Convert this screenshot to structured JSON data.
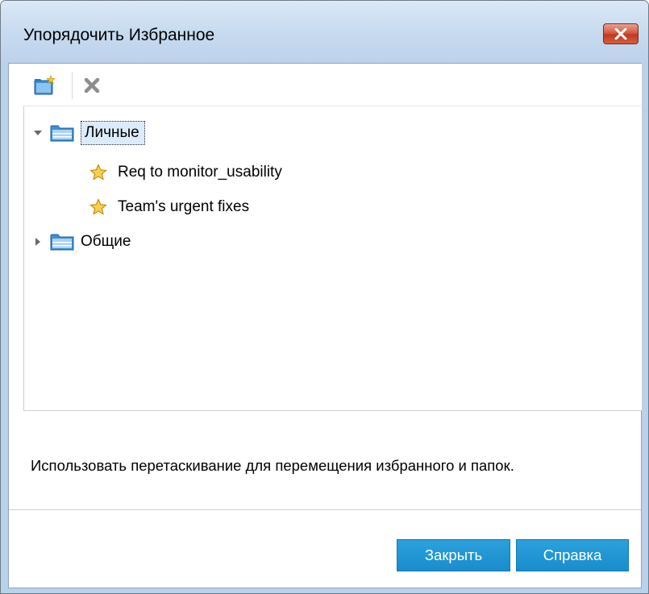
{
  "window": {
    "title": "Упорядочить Избранное"
  },
  "toolbar": {
    "new_folder_icon": "new-folder-icon",
    "delete_icon": "delete-icon"
  },
  "tree": {
    "personal": {
      "label": "Личные",
      "expanded": true,
      "selected": true,
      "items": [
        {
          "label": "Req to monitor_usability",
          "icon": "star-icon"
        },
        {
          "label": "Team's urgent fixes",
          "icon": "star-icon"
        }
      ]
    },
    "public": {
      "label": "Общие",
      "expanded": false
    }
  },
  "hint_text": "Использовать перетаскивание для перемещения избранного и папок.",
  "buttons": {
    "close": "Закрыть",
    "help": "Справка"
  },
  "colors": {
    "accent": "#1a8ccc",
    "selection": "#dcebfc",
    "titlebar": "#c6d9ef"
  }
}
